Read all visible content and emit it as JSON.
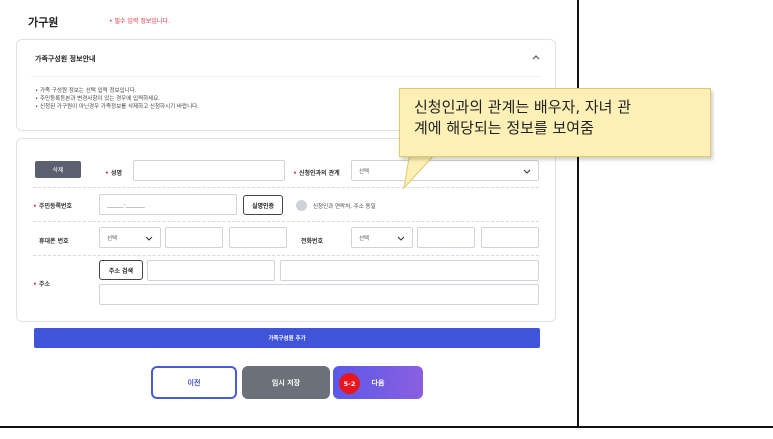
{
  "section": {
    "title": "가구원",
    "required_note": "• 필수 입력 정보입니다."
  },
  "info_box": {
    "title": "가족구성원 정보안내",
    "lines": [
      "• 가족 구성원 정보는 선택 입력 정보입니다.",
      "• 주민등록등본과 변경사항이 있는 경우에 입력하세요.",
      "• 신청된 가구원이 아닌경우 가족정보를 삭제하고 신청하시기 바랍니다."
    ]
  },
  "form": {
    "delete_label": "삭제",
    "name_label": "성명",
    "relation_label": "신청인과의 관계",
    "relation_select": "선택",
    "rrn_label": "주민등록번호",
    "rrn_value": "______-_______",
    "verify_button": "실명인증",
    "verify_note": "신청인과 연락처, 주소 동일",
    "mobile_label": "휴대폰 번호",
    "mobile_select": "선택",
    "phone_label": "전화번호",
    "phone_select": "선택",
    "address_label": "주소",
    "address_search": "주소 검색",
    "required_mark": "•"
  },
  "add_member": "가족구성원 추가",
  "buttons": {
    "prev": "이전",
    "temp_save": "임시 저장",
    "next": "다음",
    "step_badge": "5-2"
  },
  "callout": {
    "line1": "신청인과의 관계는 배우자, 자녀 관",
    "line2": "계에 해당되는 정보를 보여줌"
  },
  "colors": {
    "primary": "#3f54d8",
    "required": "#e0314a",
    "badge": "#e8151e",
    "callout_bg": "#fdf0b6"
  }
}
